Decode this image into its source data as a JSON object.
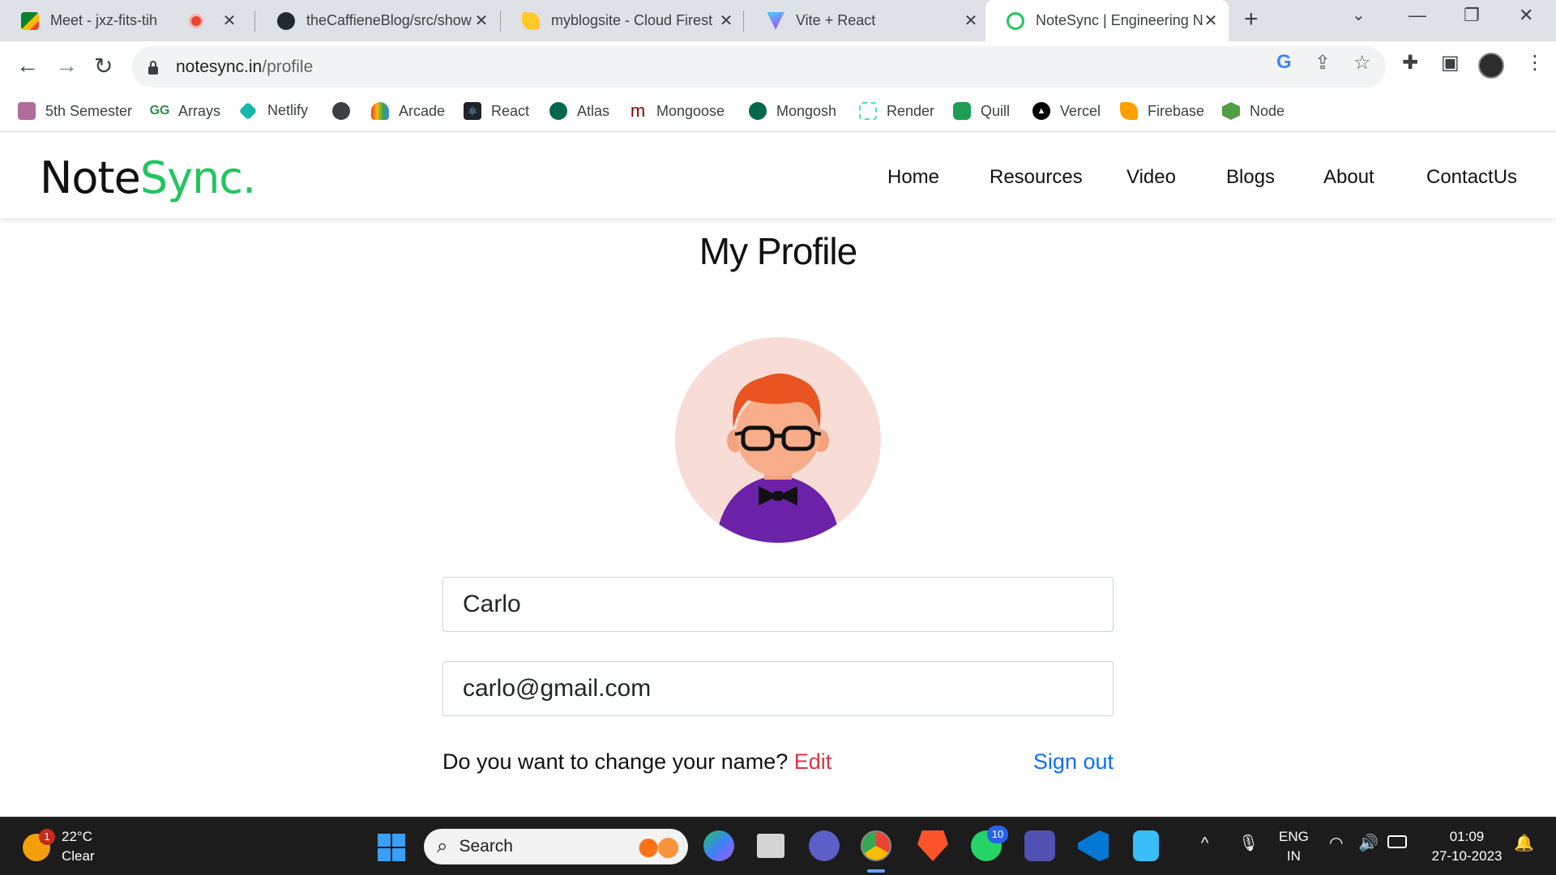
{
  "browser": {
    "tabs": [
      {
        "title": "Meet - jxz-fits-tih",
        "icon": "google-meet-icon",
        "color": "#00832d",
        "recording": true
      },
      {
        "title": "theCaffieneBlog/src/show",
        "icon": "github-icon",
        "color": "#24292f"
      },
      {
        "title": "myblogsite - Cloud Firest",
        "icon": "firebase-icon",
        "color": "#ffca28"
      },
      {
        "title": "Vite + React",
        "icon": "vite-icon",
        "color": "#a855f7"
      },
      {
        "title": "NoteSync | Engineering N",
        "icon": "notesync-icon",
        "color": "#22c55e",
        "active": true
      }
    ],
    "new_tab": "+",
    "url_host": "notesync.in",
    "url_path": "/profile",
    "bookmarks": [
      {
        "label": "5th Semester",
        "icon": "folder-icon",
        "color": "#b06c9a"
      },
      {
        "label": "Arrays",
        "icon": "gfg-icon",
        "color": "#2f8d46"
      },
      {
        "label": "Netlify",
        "icon": "netlify-icon",
        "color": "#14b8a6"
      },
      {
        "label": "",
        "icon": "globe-icon",
        "color": "#3c4043"
      },
      {
        "label": "Arcade",
        "icon": "google-cloud-icon",
        "color": "#4285f4"
      },
      {
        "label": "React",
        "icon": "react-icon",
        "color": "#20232a"
      },
      {
        "label": "Atlas",
        "icon": "mongodb-icon",
        "color": "#00684a"
      },
      {
        "label": "Mongoose",
        "icon": "mongoose-icon",
        "color": "#880000"
      },
      {
        "label": "Mongosh",
        "icon": "mongodb-icon",
        "color": "#00684a"
      },
      {
        "label": "Render",
        "icon": "render-icon",
        "color": "#46e3b7"
      },
      {
        "label": "Quill",
        "icon": "quill-icon",
        "color": "#1f9d55"
      },
      {
        "label": "Vercel",
        "icon": "vercel-icon",
        "color": "#000000"
      },
      {
        "label": "Firebase",
        "icon": "firebase-icon",
        "color": "#ffa000"
      },
      {
        "label": "Node",
        "icon": "nodejs-icon",
        "color": "#539e43"
      }
    ]
  },
  "site": {
    "logo_part1": "Note",
    "logo_part2": "Sync.",
    "brand_color": "#22c55e",
    "nav": [
      "Home",
      "Resources",
      "Video",
      "Blogs",
      "About",
      "ContactUs"
    ]
  },
  "profile": {
    "title": "My Profile",
    "name_value": "Carlo",
    "email_value": "carlo@gmail.com",
    "change_prompt": "Do you want to change your name?",
    "edit_label": "Edit",
    "signout_label": "Sign out",
    "edit_color": "#dc3545",
    "signout_color": "#0d6efd"
  },
  "taskbar": {
    "weather_temp": "22°C",
    "weather_desc": "Clear",
    "weather_badge": "1",
    "search_placeholder": "Search",
    "whatsapp_badge": "10",
    "lang_top": "ENG",
    "lang_bottom": "IN",
    "time": "01:09",
    "date": "27-10-2023"
  }
}
